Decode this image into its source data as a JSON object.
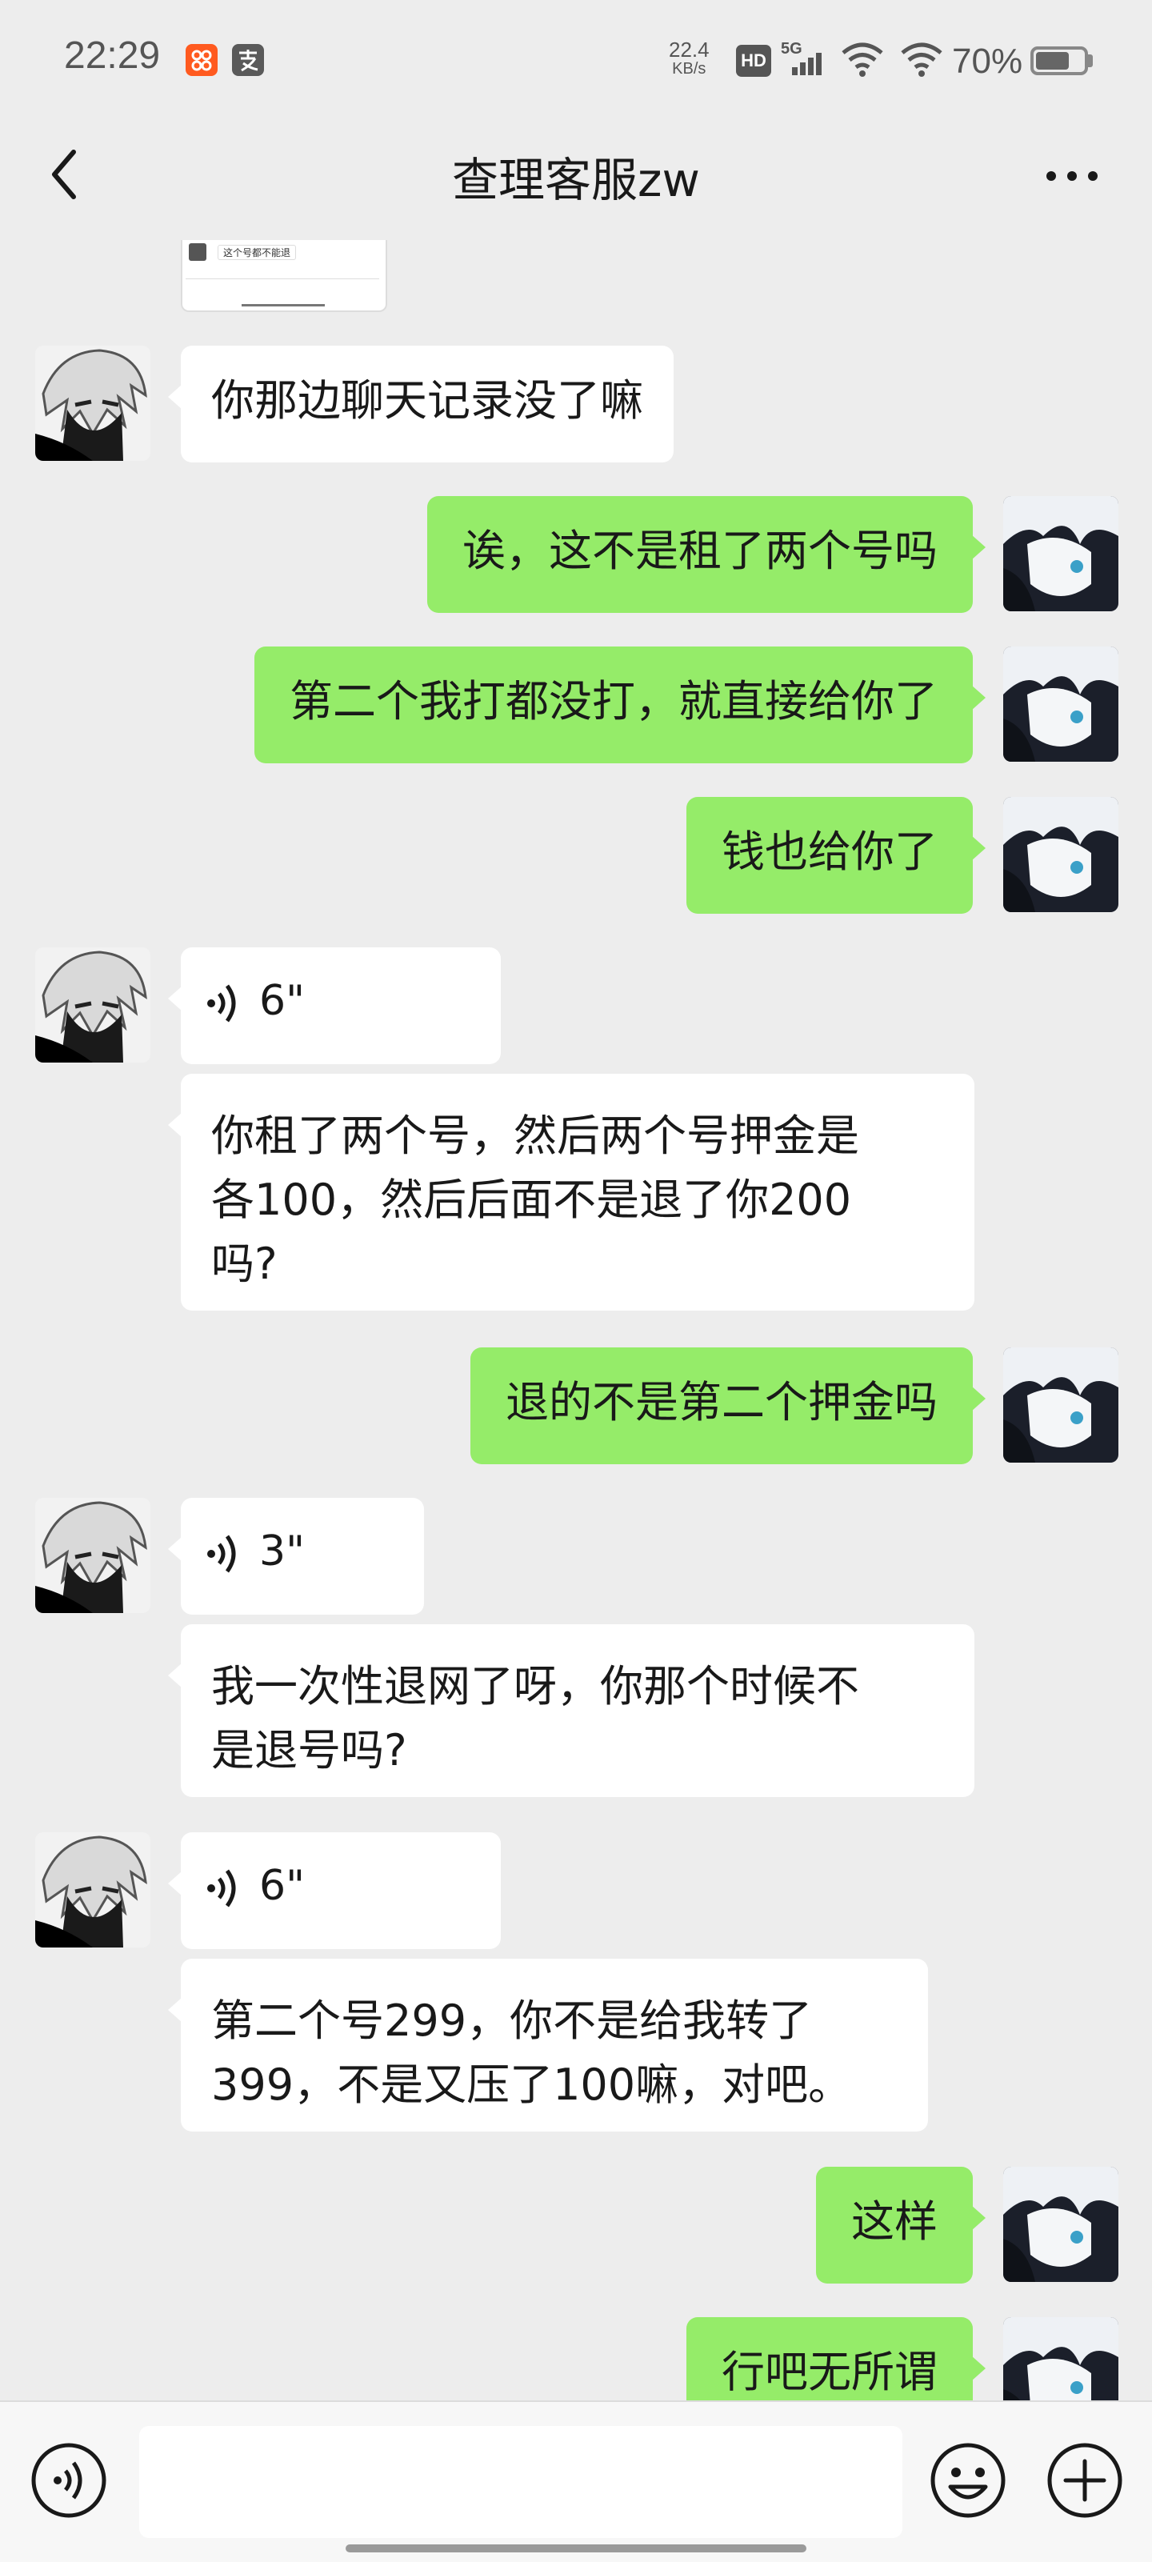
{
  "status_bar": {
    "time": "22:29",
    "net_speed_value": "22.4",
    "net_speed_unit": "KB/s",
    "hd_label": "HD",
    "signal_label": "5G",
    "battery_percent": "70%",
    "battery_level": 0.7
  },
  "nav": {
    "title": "查理客服zw"
  },
  "messages": [
    {
      "side": "left",
      "type": "text",
      "text": "你那边聊天记录没了嘛"
    },
    {
      "side": "right",
      "type": "text",
      "text": "诶，这不是租了两个号吗"
    },
    {
      "side": "right",
      "type": "text",
      "text": "第二个我打都没打，就直接给你了"
    },
    {
      "side": "right",
      "type": "text",
      "text": "钱也给你了"
    },
    {
      "side": "left",
      "type": "voice",
      "duration": "6\""
    },
    {
      "side": "left",
      "type": "text",
      "lines": [
        "你租了两个号，然后两个号押金是",
        "各100，然后后面不是退了你200",
        "吗?"
      ]
    },
    {
      "side": "right",
      "type": "text",
      "text": "退的不是第二个押金吗"
    },
    {
      "side": "left",
      "type": "voice",
      "duration": "3\""
    },
    {
      "side": "left",
      "type": "text",
      "lines": [
        "我一次性退网了呀，你那个时候不",
        "是退号吗?"
      ]
    },
    {
      "side": "left",
      "type": "voice",
      "duration": "6\""
    },
    {
      "side": "left",
      "type": "text",
      "lines": [
        "第二个号299，你不是给我转了",
        "399，不是又压了100嘛，对吧。"
      ]
    },
    {
      "side": "right",
      "type": "text",
      "text": "这样"
    },
    {
      "side": "right",
      "type": "text",
      "text": "行吧无所谓"
    }
  ],
  "thumbnail": {
    "caption": "这个号都不能退"
  },
  "input_bar": {
    "placeholder": ""
  }
}
